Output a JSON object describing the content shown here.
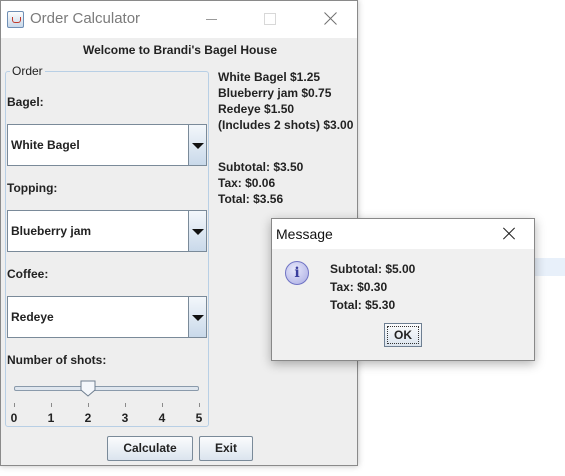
{
  "window": {
    "title": "Order Calculator"
  },
  "welcome": "Welcome to Brandi's Bagel House",
  "order": {
    "group_title": "Order",
    "bagel": {
      "label": "Bagel:",
      "selected": "White Bagel"
    },
    "topping": {
      "label": "Topping:",
      "selected": "Blueberry jam"
    },
    "coffee": {
      "label": "Coffee:",
      "selected": "Redeye"
    },
    "shots": {
      "label": "Number of shots:",
      "value": 2,
      "min": 0,
      "max": 5,
      "ticks": [
        "0",
        "1",
        "2",
        "3",
        "4",
        "5"
      ]
    }
  },
  "prices": [
    "White Bagel $1.25",
    "Blueberry jam $0.75",
    "Redeye $1.50",
    "(Includes 2 shots)  $3.00"
  ],
  "totals": [
    "Subtotal: $3.50",
    "Tax: $0.06",
    "Total: $3.56"
  ],
  "buttons": {
    "calculate": "Calculate",
    "exit": "Exit"
  },
  "dialog": {
    "title": "Message",
    "icon": "info-icon",
    "lines": [
      "Subtotal: $5.00",
      "Tax: $0.30",
      "Total: $5.30"
    ],
    "ok": "OK"
  },
  "colors": {
    "window_bg": "#eeeeee",
    "group_border": "#b8cfe5",
    "button_gradient_bottom": "#dbe4ee"
  }
}
